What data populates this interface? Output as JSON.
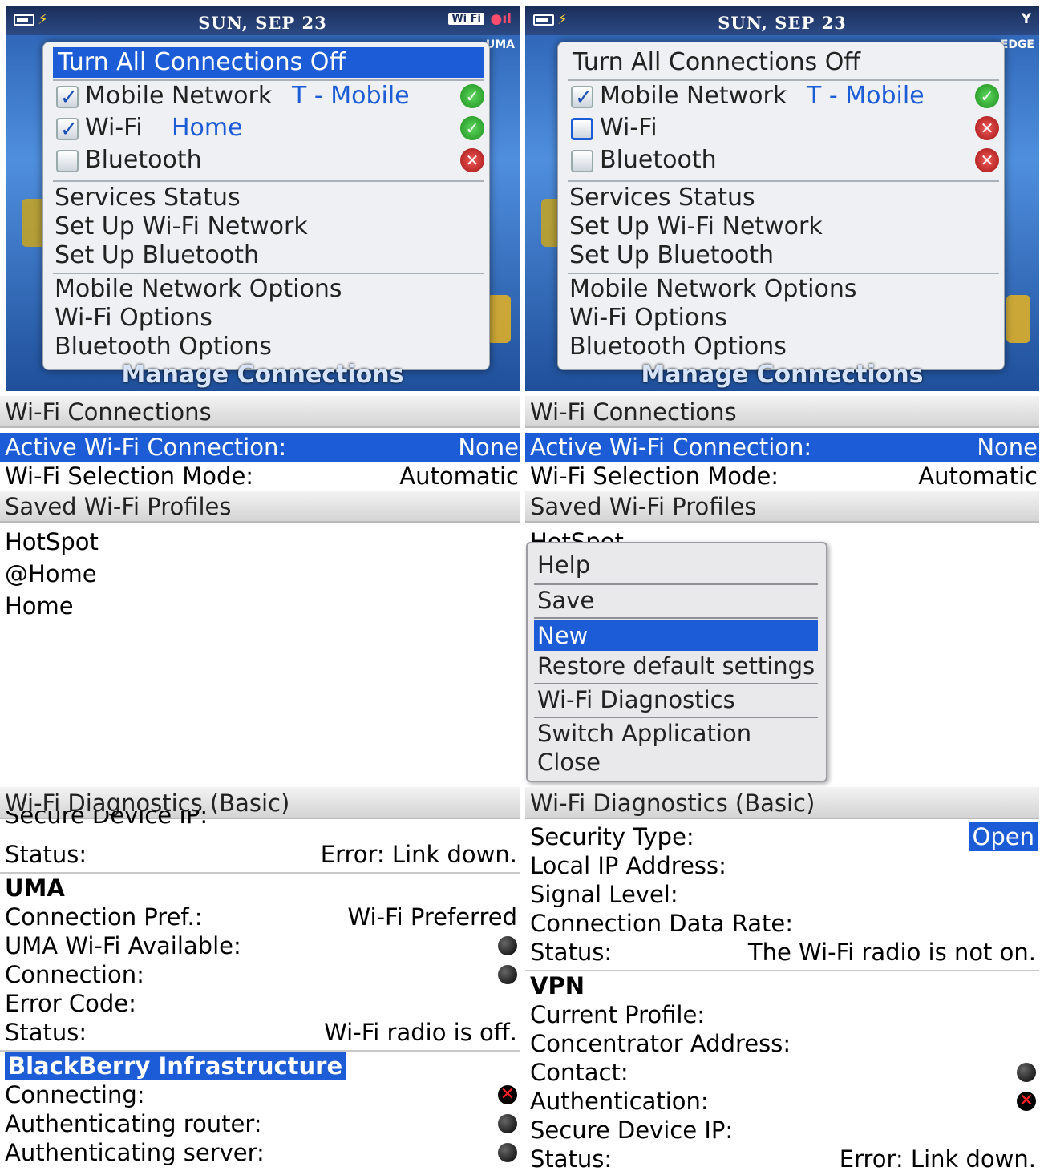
{
  "status_bar": {
    "date": "SUN, SEP 23"
  },
  "left_top": {
    "network_badge": "UMA",
    "wifi_badge": "Wi Fi",
    "turn_off": "Turn All Connections Off",
    "connections": [
      {
        "name": "Mobile Network",
        "value": "T - Mobile",
        "checked": true,
        "status": "ok"
      },
      {
        "name": "Wi-Fi",
        "value": "Home",
        "checked": true,
        "status": "ok"
      },
      {
        "name": "Bluetooth",
        "value": "",
        "checked": false,
        "status": "off"
      }
    ],
    "menu_group1": [
      "Services Status",
      "Set Up Wi-Fi Network",
      "Set Up Bluetooth"
    ],
    "menu_group2": [
      "Mobile Network Options",
      "Wi-Fi Options",
      "Bluetooth Options"
    ],
    "footer": "Manage Connections"
  },
  "right_top": {
    "network_badge": "EDGE",
    "turn_off": "Turn All Connections Off",
    "connections": [
      {
        "name": "Mobile Network",
        "value": "T - Mobile",
        "checked": true,
        "status": "ok"
      },
      {
        "name": "Wi-Fi",
        "value": "",
        "checked": false,
        "status": "off"
      },
      {
        "name": "Bluetooth",
        "value": "",
        "checked": false,
        "status": "off"
      }
    ],
    "menu_group1": [
      "Services Status",
      "Set Up Wi-Fi Network",
      "Set Up Bluetooth"
    ],
    "menu_group2": [
      "Mobile Network Options",
      "Wi-Fi Options",
      "Bluetooth Options"
    ],
    "footer": "Manage Connections"
  },
  "wifi_connections": {
    "header": "Wi-Fi Connections",
    "active_label": "Active Wi-Fi Connection:",
    "active_value": "None",
    "mode_label": "Wi-Fi Selection Mode:",
    "mode_value": "Automatic",
    "profiles_header": "Saved Wi-Fi Profiles",
    "profiles": [
      "HotSpot",
      "@Home",
      "Home"
    ]
  },
  "context_menu": {
    "items": [
      "Help",
      "Save",
      "New",
      "Restore default settings",
      "Wi-Fi Diagnostics",
      "Switch Application",
      "Close"
    ],
    "selected": "New"
  },
  "diag_left": {
    "header": "Wi-Fi Diagnostics (Basic)",
    "cut_label": "Secure Device IP:",
    "status_label": "Status:",
    "status_value": "Error: Link down.",
    "uma_title": "UMA",
    "conn_pref_label": "Connection Pref.:",
    "conn_pref_value": "Wi-Fi Preferred",
    "uma_avail_label": "UMA Wi-Fi Available:",
    "connection_label": "Connection:",
    "error_code_label": "Error Code:",
    "status2_label": "Status:",
    "status2_value": "Wi-Fi radio is off.",
    "bb_title": "BlackBerry Infrastructure",
    "connecting_label": "Connecting:",
    "auth_router_label": "Authenticating router:",
    "auth_server_label": "Authenticating server:"
  },
  "diag_right": {
    "header": "Wi-Fi Diagnostics (Basic)",
    "security_label": "Security Type:",
    "security_value": "Open",
    "local_ip_label": "Local IP Address:",
    "signal_label": "Signal Level:",
    "rate_label": "Connection Data Rate:",
    "status_label": "Status:",
    "status_value": "The Wi-Fi radio is not on.",
    "vpn_title": "VPN",
    "profile_label": "Current Profile:",
    "concentrator_label": "Concentrator Address:",
    "contact_label": "Contact:",
    "auth_label": "Authentication:",
    "secure_ip_label": "Secure Device IP:",
    "status2_label": "Status:",
    "status2_value": "Error: Link down."
  }
}
